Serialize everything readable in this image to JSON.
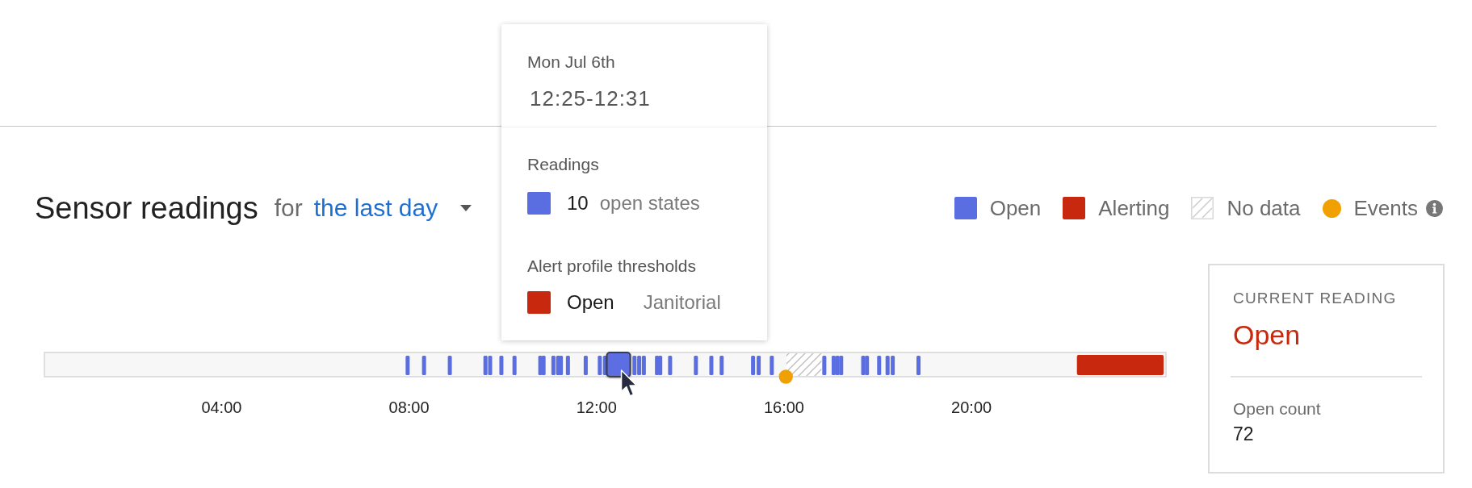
{
  "header": {
    "title": "Sensor readings",
    "range_prefix": "for",
    "range": "the last day"
  },
  "legend": [
    {
      "label": "Open",
      "kind": "swatch",
      "color": "#5b6ee1"
    },
    {
      "label": "Alerting",
      "kind": "swatch",
      "color": "#c8290e"
    },
    {
      "label": "No data",
      "kind": "hatch"
    },
    {
      "label": "Events",
      "kind": "dot",
      "color": "#f0a000"
    }
  ],
  "tooltip": {
    "date": "Mon Jul 6th",
    "time_range": "12:25-12:31",
    "readings_heading": "Readings",
    "readings": [
      {
        "count": "10",
        "label": "open states",
        "color": "#5b6ee1"
      }
    ],
    "thresholds_heading": "Alert profile thresholds",
    "thresholds": [
      {
        "state": "Open",
        "profile": "Janitorial",
        "color": "#c8290e"
      }
    ]
  },
  "timeline": {
    "ticks": [
      "04:00",
      "08:00",
      "12:00",
      "16:00",
      "20:00"
    ]
  },
  "current_reading": {
    "heading": "CURRENT READING",
    "value": "Open",
    "count_label": "Open count",
    "count": "72"
  }
}
